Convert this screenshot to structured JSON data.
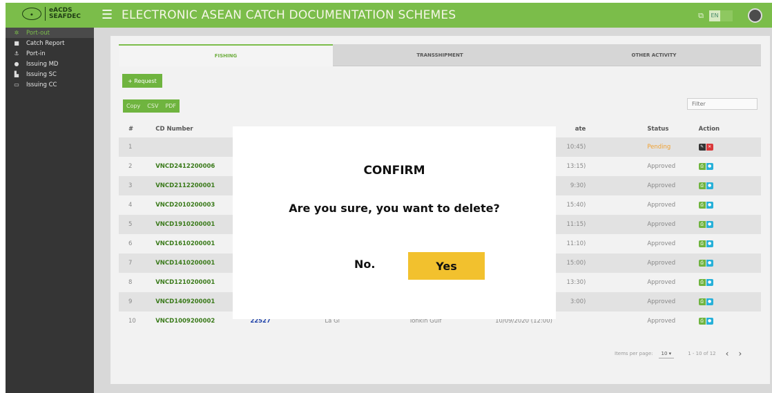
{
  "header": {
    "logo_line1": "eACDS",
    "logo_line2": "SEAFDEC",
    "title": "ELECTRONIC ASEAN CATCH DOCUMENTATION SCHEMES",
    "lang_label": "EN",
    "accent_color": "#7bbd4a"
  },
  "sidebar": {
    "items": [
      {
        "label": "Port-out",
        "icon": "anchor-icon"
      },
      {
        "label": "Catch Report",
        "icon": "file-icon"
      },
      {
        "label": "Port-in",
        "icon": "anchor-icon"
      },
      {
        "label": "Issuing MD",
        "icon": "globe-icon"
      },
      {
        "label": "Issuing SC",
        "icon": "factory-icon"
      },
      {
        "label": "Issuing CC",
        "icon": "card-icon"
      }
    ]
  },
  "tabs": [
    "FISHING",
    "TRANSSHIPMENT",
    "OTHER ACTIVITY"
  ],
  "toolbar": {
    "request_label": "+ Request",
    "export_buttons": [
      "Copy",
      "CSV",
      "PDF"
    ],
    "filter_placeholder": "Filter"
  },
  "table": {
    "headers": [
      "#",
      "CD Number",
      "",
      "",
      "",
      "ate",
      "Status",
      "Action"
    ],
    "rows": [
      {
        "num": "1",
        "cd": "",
        "vessel": "",
        "owner": "",
        "area": "",
        "date": "10:45)",
        "status": "Pending"
      },
      {
        "num": "2",
        "cd": "VNCD2412200006",
        "vessel": "",
        "owner": "",
        "area": "",
        "date": "13:15)",
        "status": "Approved"
      },
      {
        "num": "3",
        "cd": "VNCD2112200001",
        "vessel": "",
        "owner": "",
        "area": "",
        "date": "9:30)",
        "status": "Approved"
      },
      {
        "num": "4",
        "cd": "VNCD2010200003",
        "vessel": "",
        "owner": "",
        "area": "",
        "date": "15:40)",
        "status": "Approved"
      },
      {
        "num": "5",
        "cd": "VNCD1910200001",
        "vessel": "",
        "owner": "",
        "area": "",
        "date": "11:15)",
        "status": "Approved"
      },
      {
        "num": "6",
        "cd": "VNCD1610200001",
        "vessel": "",
        "owner": "",
        "area": "",
        "date": "11:10)",
        "status": "Approved"
      },
      {
        "num": "7",
        "cd": "VNCD1410200001",
        "vessel": "",
        "owner": "",
        "area": "",
        "date": "15:00)",
        "status": "Approved"
      },
      {
        "num": "8",
        "cd": "VNCD1210200001",
        "vessel": "",
        "owner": "",
        "area": "",
        "date": "13:30)",
        "status": "Approved"
      },
      {
        "num": "9",
        "cd": "VNCD1409200001",
        "vessel": "",
        "owner": "",
        "area": "",
        "date": "3:00)",
        "status": "Approved"
      },
      {
        "num": "10",
        "cd": "VNCD1009200002",
        "vessel": "22527",
        "owner": "La Gi",
        "area": "Tonkin Gulf",
        "date": "10/09/2020 (12:00)",
        "status": "Approved"
      }
    ]
  },
  "pagination": {
    "label": "Items per page:",
    "value": "10",
    "range": "1 - 10 of 12"
  },
  "modal": {
    "title": "CONFIRM",
    "message": "Are you sure, you want to delete?",
    "no_label": "No.",
    "yes_label": "Yes"
  }
}
